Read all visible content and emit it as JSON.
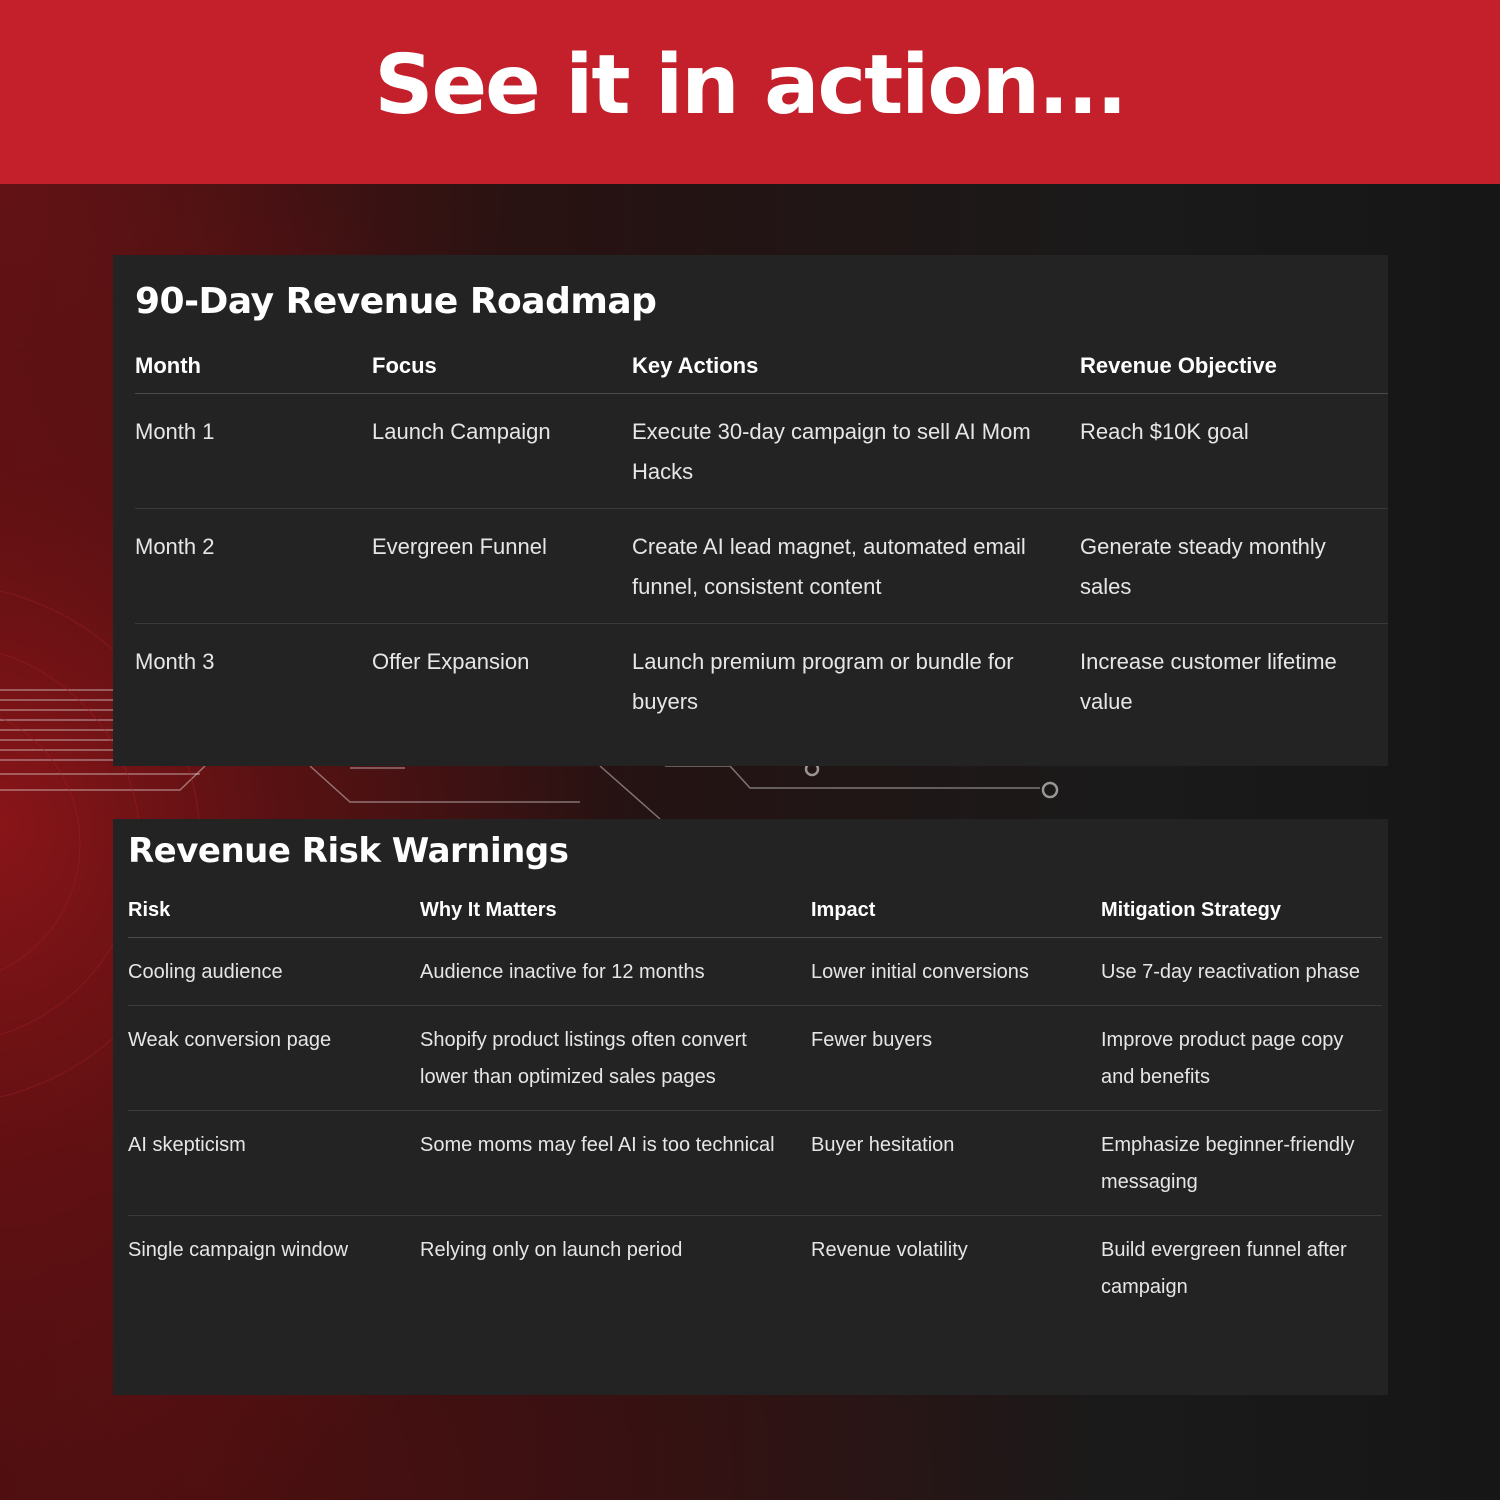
{
  "hero": {
    "title": "See it in action..."
  },
  "roadmap": {
    "title": "90-Day Revenue Roadmap",
    "headers": [
      "Month",
      "Focus",
      "Key Actions",
      "Revenue Objective"
    ],
    "rows": [
      [
        "Month 1",
        "Launch Campaign",
        "Execute 30-day campaign to sell AI Mom Hacks",
        "Reach $10K goal"
      ],
      [
        "Month 2",
        "Evergreen Funnel",
        "Create AI lead magnet, automated email funnel, consistent content",
        "Generate steady monthly sales"
      ],
      [
        "Month 3",
        "Offer Expansion",
        "Launch premium program or bundle for buyers",
        "Increase customer lifetime value"
      ]
    ]
  },
  "risks": {
    "title": "Revenue Risk Warnings",
    "headers": [
      "Risk",
      "Why It Matters",
      "Impact",
      "Mitigation Strategy"
    ],
    "rows": [
      [
        "Cooling audience",
        "Audience inactive for 12 months",
        "Lower initial conversions",
        "Use 7-day reactivation phase"
      ],
      [
        "Weak conversion page",
        "Shopify product listings often convert lower than optimized sales pages",
        "Fewer buyers",
        "Improve product page copy and benefits"
      ],
      [
        "AI skepticism",
        "Some moms may feel AI is too technical",
        "Buyer hesitation",
        "Emphasize beginner-friendly messaging"
      ],
      [
        "Single campaign window",
        "Relying only on launch period",
        "Revenue volatility",
        "Build evergreen funnel after campaign"
      ]
    ]
  },
  "colors": {
    "banner": "#c4202b",
    "card": "#232323",
    "background": "#161616"
  }
}
